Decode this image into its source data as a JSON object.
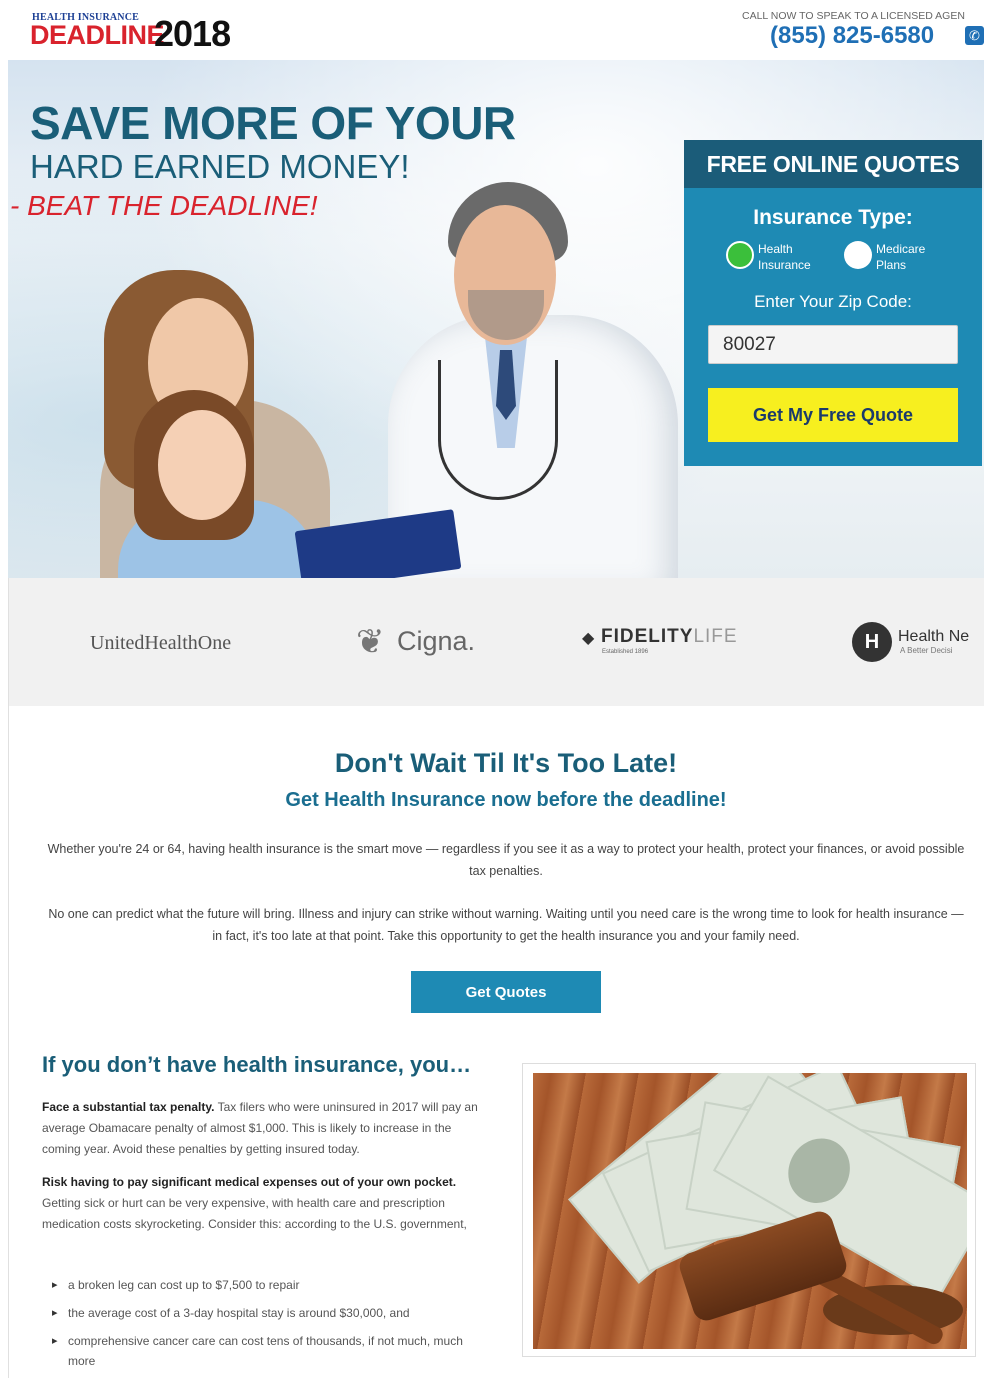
{
  "header": {
    "logo_small": "HEALTH INSURANCE",
    "logo_big": "DEADLINE",
    "logo_year": "2018",
    "call_label": "CALL NOW TO SPEAK TO A LICENSED AGEN",
    "phone": "(855) 825-6580",
    "phone_icon": "phone-icon"
  },
  "hero": {
    "headline": "SAVE MORE OF YOUR",
    "subheadline": "HARD EARNED MONEY!",
    "tagline": "- BEAT THE DEADLINE!"
  },
  "quote_form": {
    "title": "FREE ONLINE QUOTES",
    "type_label": "Insurance Type:",
    "options": [
      {
        "label_line1": "Health",
        "label_line2": "Insurance",
        "selected": true
      },
      {
        "label_line1": "Medicare",
        "label_line2": "Plans",
        "selected": false
      }
    ],
    "zip_label": "Enter Your Zip Code:",
    "zip_value": "80027",
    "button_label": "Get My Free Quote",
    "colors": {
      "panel": "#1e8ab4",
      "header": "#1b5c79",
      "button": "#f7ef1f",
      "selected_radio": "#3bbf3b"
    }
  },
  "partners": {
    "united": "UnitedHealthOne",
    "cigna": "Cigna.",
    "fidelity_main": "FIDELITY",
    "fidelity_life": "LIFE",
    "fidelity_sub": "Established 1896",
    "healthnetwork": "Health Ne",
    "healthnetwork_sub": "A Better Decisi",
    "healthnetwork_mark": "H"
  },
  "main": {
    "title": "Don't Wait Til It's Too Late!",
    "subtitle": "Get Health Insurance now before the deadline!",
    "paragraph1": "Whether you're 24 or 64, having health insurance is the smart move — regardless if you see it as a way to protect your health, protect your finances, or avoid possible tax penalties.",
    "paragraph2": "No one can predict what the future will bring. Illness and injury can strike without warning. Waiting until you need care is the wrong time to look for health insurance — in fact, it's too late at that point. Take this opportunity to get the health insurance you and your family need.",
    "cta_label": "Get Quotes"
  },
  "consequences": {
    "title": "If you don’t have health insurance, you…",
    "item1_bold": "Face a substantial tax penalty.",
    "item1_text": " Tax filers who were uninsured in 2017 will pay an average Obamacare penalty of almost $1,000. This is likely to increase in the coming year. Avoid these penalties by getting insured today.",
    "item2_bold": "Risk having to pay significant medical expenses out of your own pocket.",
    "item2_text": " Getting sick or hurt can be very expensive, with health care and prescription medication costs skyrocketing. Consider this: according to the U.S. government,",
    "bullets": [
      "a broken leg can cost up to $7,500 to repair",
      "the average cost of a 3-day hospital stay is around $30,000, and",
      "comprehensive cancer care can cost tens of thousands, if not much, much more"
    ]
  },
  "colors": {
    "brand_dark": "#1a5e78",
    "accent_red": "#d9232d",
    "accent_blue": "#1e8ab4"
  }
}
